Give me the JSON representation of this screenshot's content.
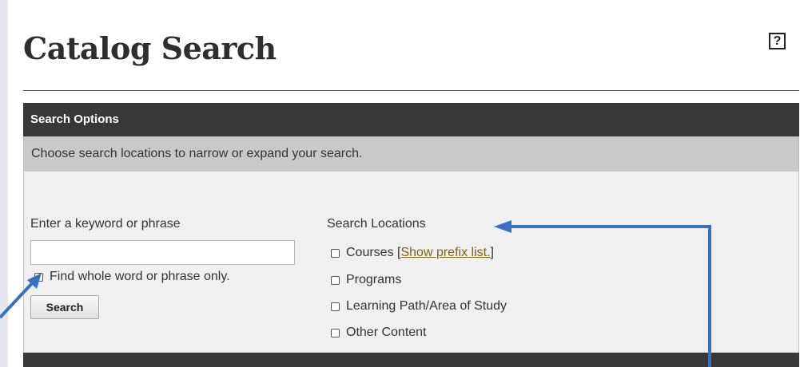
{
  "page": {
    "title": "Catalog Search",
    "help_symbol": "?"
  },
  "panel": {
    "header": "Search Options",
    "subheader": "Choose search locations to narrow or expand your search."
  },
  "keyword": {
    "label": "Enter a keyword or phrase",
    "value": "",
    "placeholder": "",
    "whole_word_label": "Find whole word or phrase only.",
    "search_button": "Search"
  },
  "locations": {
    "label": "Search Locations",
    "courses": "Courses",
    "bracket_open": "[",
    "show_prefix_link": "Show prefix list.",
    "bracket_close": "]",
    "programs": "Programs",
    "learning_path": "Learning Path/Area of Study",
    "other_content": "Other Content"
  },
  "colors": {
    "annotation_arrow": "#3a6fc4",
    "header_bg": "#383838",
    "link": "#7a6513"
  },
  "icons": {
    "help": "help-icon",
    "arrow_left": "arrow-annotation-icon",
    "arrow_right": "arrow-annotation-icon"
  }
}
